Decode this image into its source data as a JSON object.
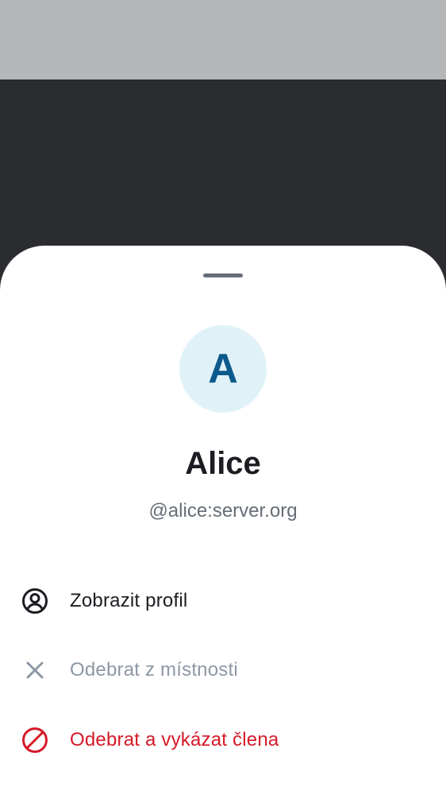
{
  "member": {
    "avatar_letter": "A",
    "display_name": "Alice",
    "user_id": "@alice:server.org"
  },
  "actions": [
    {
      "label": "Zobrazit profil",
      "icon": "user-profile-icon",
      "color": "#1b1d22"
    },
    {
      "label": "Odebrat z místnosti",
      "icon": "close-icon",
      "color": "#8d97a5"
    },
    {
      "label": "Odebrat a vykázat člena",
      "icon": "ban-icon",
      "color": "#d51928"
    }
  ],
  "colors": {
    "background_scrim": "#2b2c2f",
    "status_bar": "#b5b6b8",
    "sheet": "#ffffff",
    "avatar_bg": "#e0f2f8",
    "avatar_fg": "#0b5a8c",
    "critical": "#d51928"
  }
}
